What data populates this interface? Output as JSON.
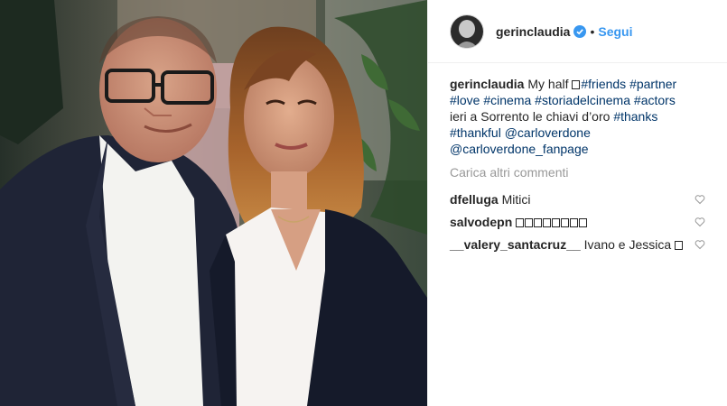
{
  "header": {
    "username": "gerinclaudia",
    "dot": "•",
    "follow_label": "Segui"
  },
  "caption": {
    "username": "gerinclaudia",
    "text_before": "My half",
    "hashtags_line1": [
      "#friends",
      "#partner"
    ],
    "hashtags_line2": [
      "#love",
      "#cinema",
      "#storiadelcinema",
      "#actors"
    ],
    "text_line3": "ieri a Sorrento le chiavi d’oro",
    "hashtag_line3": "#thanks",
    "hashtag_line4": "#thankful",
    "mention_1": "@carloverdone",
    "mention_2": "@carloverdone_fanpage"
  },
  "load_more_label": "Carica altri commenti",
  "comments": [
    {
      "username": "dfelluga",
      "text": "Mitici"
    },
    {
      "username": "salvodepn",
      "text": ""
    },
    {
      "username": "__valery_santacruz__",
      "text": "Ivano e Jessica"
    }
  ],
  "icons": {
    "verified": "verified-badge-icon",
    "heart": "heart-outline-icon"
  },
  "colors": {
    "accent": "#3897f0",
    "link": "#003569",
    "muted": "#999999"
  }
}
